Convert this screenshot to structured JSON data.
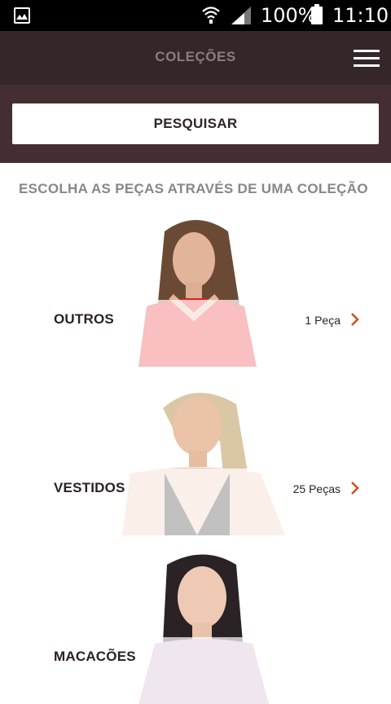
{
  "status_bar": {
    "battery_pct": "100%",
    "time": "11:10"
  },
  "app_bar": {
    "title": "COLEÇÕES"
  },
  "search": {
    "button_label": "PESQUISAR"
  },
  "section": {
    "heading": "ESCOLHA AS PEÇAS ATRAVÉS DE UMA COLEÇÃO"
  },
  "collections": [
    {
      "name": "OUTROS",
      "count": "1 Peça"
    },
    {
      "name": "VESTIDOS",
      "count": "25 Peças"
    },
    {
      "name": "MACACÕES",
      "count": ""
    }
  ],
  "colors": {
    "app_bar_bg": "#35262a",
    "search_bg": "#452e31",
    "accent_chevron": "#d0521b"
  }
}
